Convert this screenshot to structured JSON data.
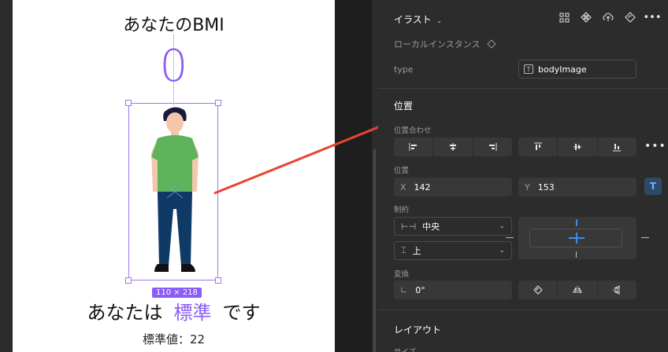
{
  "canvas": {
    "title": "あなたのBMI",
    "bmi_value": "0",
    "size_badge": "110 × 218",
    "result_prefix": "あなたは",
    "result_highlight": "標準",
    "result_suffix": "です",
    "standard_value": "標準値：22",
    "accent_color": "#8b5cf6"
  },
  "panel": {
    "layer_name": "イラスト",
    "local_instance": "ローカルインスタンス",
    "type_label": "type",
    "type_value": "bodyImage",
    "position_section": "位置",
    "alignment_label": "位置合わせ",
    "position_label": "位置",
    "x_label": "X",
    "x_value": "142",
    "y_label": "Y",
    "y_value": "153",
    "constraints_label": "制約",
    "h_constraint": "中央",
    "v_constraint": "上",
    "transform_label": "変換",
    "rotation_value": "0°",
    "layout_section": "レイアウト",
    "size_label": "サイズ"
  }
}
